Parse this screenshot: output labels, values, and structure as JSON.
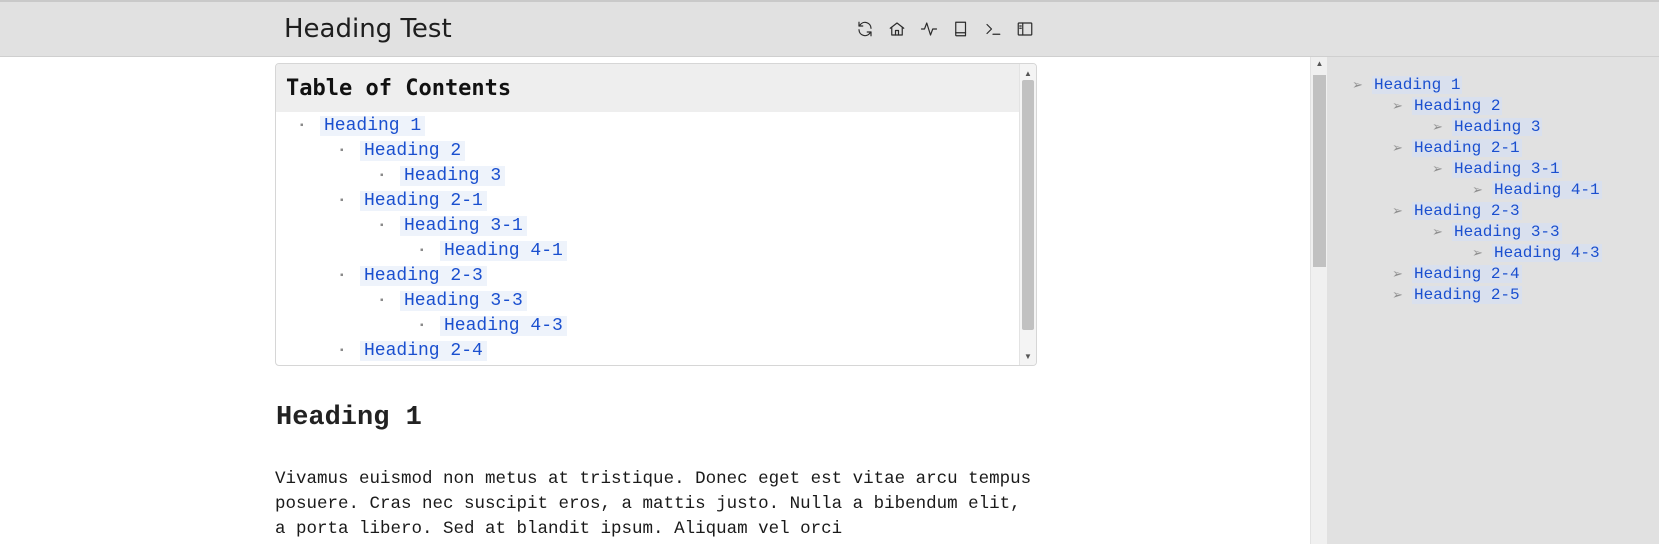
{
  "header": {
    "title": "Heading Test",
    "toolbar": [
      {
        "icon": "refresh-icon"
      },
      {
        "icon": "home-icon"
      },
      {
        "icon": "activity-icon"
      },
      {
        "icon": "book-icon"
      },
      {
        "icon": "terminal-icon"
      },
      {
        "icon": "sidebar-toggle-icon"
      }
    ]
  },
  "toc": {
    "title": "Table of Contents",
    "items": [
      {
        "label": "Heading 1",
        "level": 1
      },
      {
        "label": "Heading 2",
        "level": 2
      },
      {
        "label": "Heading 3",
        "level": 3
      },
      {
        "label": "Heading 2-1",
        "level": 2
      },
      {
        "label": "Heading 3-1",
        "level": 3
      },
      {
        "label": "Heading 4-1",
        "level": 4
      },
      {
        "label": "Heading 2-3",
        "level": 2
      },
      {
        "label": "Heading 3-3",
        "level": 3
      },
      {
        "label": "Heading 4-3",
        "level": 4
      },
      {
        "label": "Heading 2-4",
        "level": 2
      }
    ]
  },
  "content": {
    "heading": "Heading 1",
    "paragraph": "Vivamus euismod non metus at tristique. Donec eget est vitae arcu tempus posuere. Cras nec suscipit eros, a mattis justo. Nulla a bibendum elit, a porta libero. Sed at blandit ipsum. Aliquam vel orci"
  },
  "sidebar": {
    "items": [
      {
        "label": "Heading 1",
        "level": 1
      },
      {
        "label": "Heading 2",
        "level": 2
      },
      {
        "label": "Heading 3",
        "level": 3
      },
      {
        "label": "Heading 2-1",
        "level": 2
      },
      {
        "label": "Heading 3-1",
        "level": 3
      },
      {
        "label": "Heading 4-1",
        "level": 4
      },
      {
        "label": "Heading 2-3",
        "level": 2
      },
      {
        "label": "Heading 3-3",
        "level": 3
      },
      {
        "label": "Heading 4-3",
        "level": 4
      },
      {
        "label": "Heading 2-4",
        "level": 2
      },
      {
        "label": "Heading 2-5",
        "level": 2
      }
    ]
  },
  "colors": {
    "link": "#1a4fcf",
    "header_bg": "#e1e1e1",
    "sidebar_bg": "#e1e1e1"
  }
}
